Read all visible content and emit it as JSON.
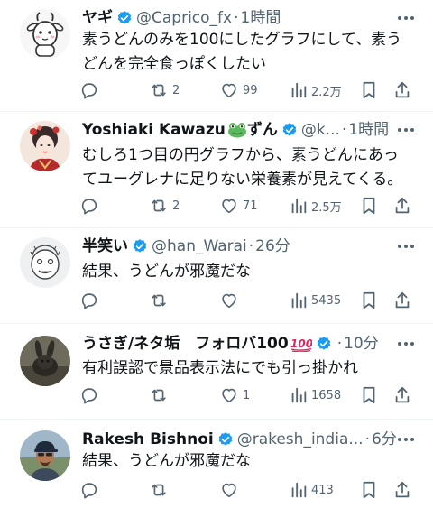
{
  "posts": [
    {
      "name": "ヤギ",
      "handle": "@Caprico_fx",
      "dot": "·",
      "time": "1時間",
      "lines": [
        "素うどんのみを100にしたグラフにして、素う",
        "どんを完全食っぽくしたい"
      ],
      "retweets": "2",
      "likes": "99",
      "views": "2.2万",
      "avatar_icon": "goat-icon"
    },
    {
      "name": "Yoshiaki Kawazu",
      "name_suffix": "ずん",
      "name_emoji": "frog-emoji",
      "handle": "@k...",
      "dot": "·",
      "time": "1時間",
      "lines": [
        "むしろ1つ目の円グラフから、素うどんにあっ",
        "てユーグレナに足りない栄養素が見えてくる。"
      ],
      "retweets": "2",
      "likes": "71",
      "views": "2.5万",
      "avatar_icon": "illustrated-person-avatar"
    },
    {
      "name": "半笑い",
      "handle": "@han_Warai",
      "dot": "·",
      "time": "26分",
      "lines": [
        "結果、うどんが邪魔だな"
      ],
      "retweets": "",
      "likes": "",
      "views": "5435",
      "avatar_icon": "sketch-face-avatar"
    },
    {
      "name": "うさぎ/ネタ垢　フォロバ100",
      "name_emoji": "hundred-points-emoji",
      "handle": "",
      "dot": "·",
      "time": "10分",
      "lines": [
        "有利誤認で景品表示法にでも引っ掛かれ"
      ],
      "retweets": "",
      "likes": "1",
      "views": "1658",
      "avatar_icon": "rabbit-photo-avatar"
    },
    {
      "name": "Rakesh Bishnoi",
      "handle": "@rakesh_india...",
      "dot": "·",
      "time": "6分",
      "lines": [
        "結果、うどんが邪魔だな"
      ],
      "retweets": "",
      "likes": "",
      "views": "413",
      "avatar_icon": "man-with-cap-avatar"
    }
  ],
  "colors": {
    "text": "#0f1419",
    "secondary": "#536471",
    "verified": "#1d9bf0",
    "divider": "#eff3f4",
    "hundred": "#e0245e"
  }
}
